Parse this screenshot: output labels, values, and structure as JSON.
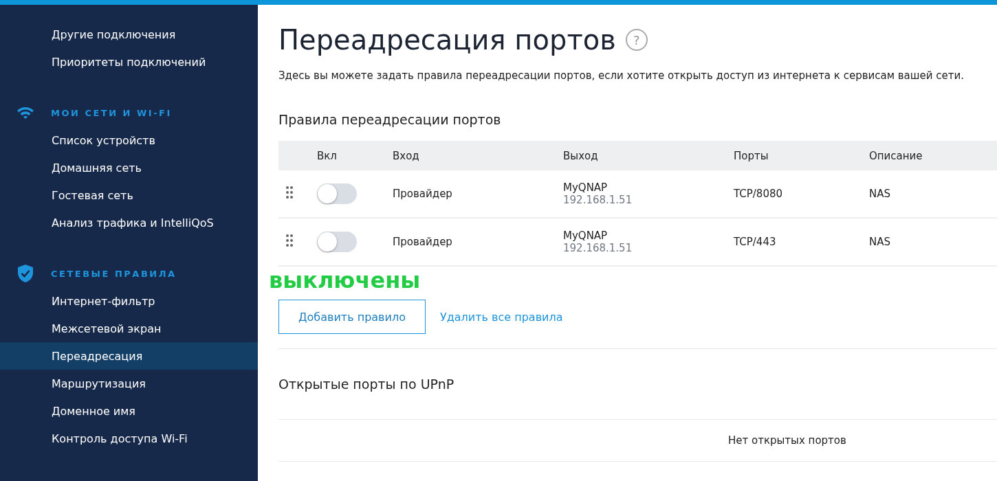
{
  "sidebar": {
    "sections": [
      {
        "items": [
          {
            "label": "Другие подключения",
            "selected": false
          },
          {
            "label": "Приоритеты подключений",
            "selected": false
          }
        ]
      },
      {
        "kind": "wifi",
        "title": "МОИ СЕТИ И WI-FI",
        "items": [
          {
            "label": "Список устройств",
            "selected": false
          },
          {
            "label": "Домашняя сеть",
            "selected": false
          },
          {
            "label": "Гостевая сеть",
            "selected": false
          },
          {
            "label": "Анализ трафика и IntelliQoS",
            "selected": false
          }
        ]
      },
      {
        "kind": "shield",
        "title": "СЕТЕВЫЕ ПРАВИЛА",
        "items": [
          {
            "label": "Интернет-фильтр",
            "selected": false
          },
          {
            "label": "Межсетевой экран",
            "selected": false
          },
          {
            "label": "Переадресация",
            "selected": true
          },
          {
            "label": "Маршрутизация",
            "selected": false
          },
          {
            "label": "Доменное имя",
            "selected": false
          },
          {
            "label": "Контроль доступа Wi-Fi",
            "selected": false
          }
        ]
      }
    ]
  },
  "page": {
    "title": "Переадресация портов",
    "help": "?",
    "description": "Здесь вы можете задать правила переадресации портов, если хотите открыть доступ из интернета к сервисам вашей сети."
  },
  "rules": {
    "title": "Правила переадресации портов",
    "columns": [
      "Вкл",
      "Вход",
      "Выход",
      "Порты",
      "Описание"
    ],
    "rows": [
      {
        "on": false,
        "input": "Провайдер",
        "output": "MyQNAP",
        "address": "192.168.1.51",
        "ports": "TCP/8080",
        "description": "NAS"
      },
      {
        "on": false,
        "input": "Провайдер",
        "output": "MyQNAP",
        "address": "192.168.1.51",
        "ports": "TCP/443",
        "description": "NAS"
      }
    ],
    "annotation": "выключены",
    "add_button": "Добавить правило",
    "delete_link": "Удалить все правила"
  },
  "upnp": {
    "title": "Открытые порты по UPnP",
    "empty": "Нет открытых портов"
  }
}
